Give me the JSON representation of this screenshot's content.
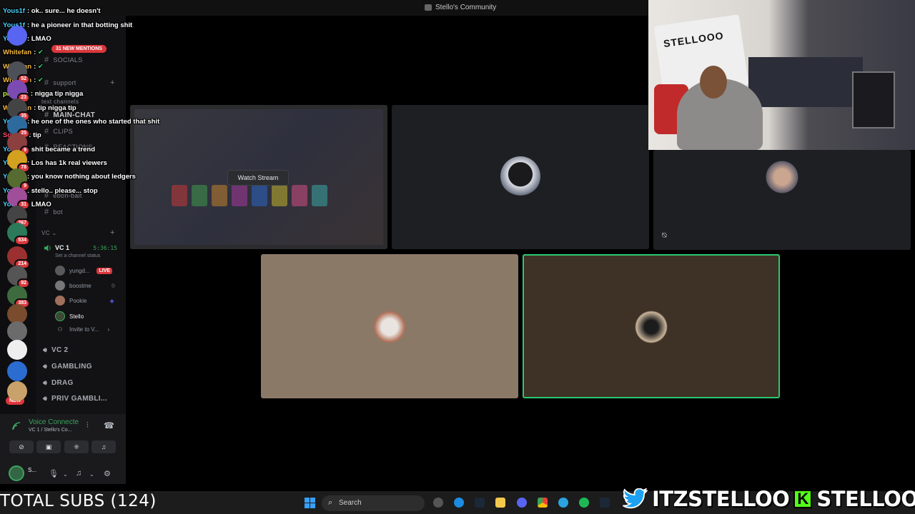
{
  "window": {
    "title": "Stello's Community"
  },
  "chat": [
    {
      "user": "Yous1f",
      "color": "#4fd1ff",
      "text": ": ok.. sure... he doesn't"
    },
    {
      "user": "Yous1f",
      "color": "#4fd1ff",
      "text": ": he a pioneer in that botting shit"
    },
    {
      "user": "Yous1f",
      "color": "#4fd1ff",
      "text": ": LMAO"
    },
    {
      "user": "Whitefan",
      "color": "#f5b942",
      "text": ":"
    },
    {
      "user": "Whitefan",
      "color": "#f5b942",
      "text": ":"
    },
    {
      "user": "Whitefan",
      "color": "#f5b942",
      "text": ":"
    },
    {
      "user": "pigballs",
      "color": "#c6ff3a",
      "text": ": nigga tip nigga"
    },
    {
      "user": "Whitefan",
      "color": "#f5b942",
      "text": ": tip nigga tip"
    },
    {
      "user": "Yous1f",
      "color": "#4fd1ff",
      "text": ": he one of the ones who started that shit"
    },
    {
      "user": "Sockee",
      "color": "#ff4d6d",
      "text": ": tip"
    },
    {
      "user": "Yous1f",
      "color": "#4fd1ff",
      "text": ": shit became a trend"
    },
    {
      "user": "Yous1f",
      "color": "#4fd1ff",
      "text": ": Los has 1k real viewers"
    },
    {
      "user": "Yous1f",
      "color": "#4fd1ff",
      "text": ": you know nothing about ledgers"
    },
    {
      "user": "Yous1f",
      "color": "#4fd1ff",
      "text": ": stello.. please... stop"
    },
    {
      "user": "Yous1f",
      "color": "#4fd1ff",
      "text": ": LMAO"
    }
  ],
  "sidebar": {
    "mentions": "31 NEW MENTIONS",
    "channels": {
      "socials": "SOCIALS",
      "support": "support",
      "text_channels": "text channels",
      "main_chat": "MAIN-CHAT",
      "clips": "CLIPS",
      "reactions": "REACTIONS",
      "ebon_bait": "ebon-bait",
      "bot": "bot"
    },
    "vc_category": "VC",
    "vc1": {
      "name": "VC 1",
      "time": "5:36:15",
      "status": "Set a channel status"
    },
    "members": [
      {
        "name": "yungd...",
        "live": "LIVE"
      },
      {
        "name": "boostme"
      },
      {
        "name": "Pookie"
      },
      {
        "name": "Stello"
      }
    ],
    "invite": "Invite to V...",
    "voice_channels": [
      "VC 2",
      "GAMBLING",
      "DRAG",
      "PRIV GAMBLI..."
    ],
    "voice_status": {
      "title": "Voice Connecte",
      "sub": "VC 1 / Stello's Co..."
    },
    "user": {
      "name": "S..."
    },
    "server_badges": [
      "52",
      "23",
      "35",
      "25",
      "9",
      "78",
      "9",
      "31",
      "267",
      "534",
      "214",
      "92",
      "383"
    ],
    "new_label": "NEW"
  },
  "stream": {
    "watch_label": "Watch Stream"
  },
  "taskbar": {
    "subs": "TOTAL SUBS (124)",
    "search": "Search"
  },
  "social": {
    "twitter": "ITZSTELLOO",
    "kick_letter": "K",
    "kick": "STELLOOO"
  },
  "webcam": {
    "sign": "STELLOOO"
  },
  "colors": {
    "speaking": "#2dc770",
    "live": "#da373c",
    "discord_green": "#3ba55d"
  }
}
